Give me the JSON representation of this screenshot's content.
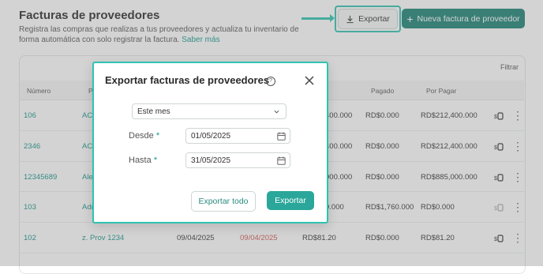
{
  "header": {
    "title": "Facturas de proveedores",
    "subtitle": "Registra las compras que realizas a tus proveedores y actualiza tu inventario de forma automática con solo registrar la factura.",
    "learn_more": "Saber más",
    "export_label": "Exportar",
    "new_label": "Nueva factura de proveedor"
  },
  "table": {
    "filter_label": "Filtrar",
    "columns": [
      "Número",
      "P",
      "Pagado",
      "Por Pagar"
    ],
    "rows": [
      {
        "numero": "106",
        "prov": "AC",
        "fecha": "",
        "venc": "",
        "total": "400.000",
        "pagado": "RD$0.000",
        "por_pagar": "RD$212,400.000"
      },
      {
        "numero": "2346",
        "prov": "AC",
        "fecha": "",
        "venc": "",
        "total": "400.000",
        "pagado": "RD$0.000",
        "por_pagar": "RD$212,400.000"
      },
      {
        "numero": "12345689",
        "prov": "Ale",
        "fecha": "",
        "venc": "",
        "total": "000.000",
        "pagado": "RD$0.000",
        "por_pagar": "RD$885,000.000"
      },
      {
        "numero": "103",
        "prov": "Adr",
        "fecha": "",
        "venc": "",
        "total": "0.000",
        "pagado": "RD$1,760.000",
        "por_pagar": "RD$0.000"
      },
      {
        "numero": "102",
        "prov": "z. Prov 1234",
        "fecha": "09/04/2025",
        "venc": "09/04/2025",
        "total": "RD$81.20",
        "pagado": "RD$0.000",
        "por_pagar": "RD$81.20"
      }
    ]
  },
  "modal": {
    "title": "Exportar facturas de proveedores",
    "period_value": "Este mes",
    "from_label": "Desde",
    "from_value": "01/05/2025",
    "to_label": "Hasta",
    "to_value": "31/05/2025",
    "required_mark": "*",
    "export_all_label": "Exportar todo",
    "export_label": "Exportar"
  },
  "colors": {
    "accent": "#1b8275",
    "teal_highlight": "#2fc3b1",
    "link": "#17968a",
    "overdue": "#d05555"
  }
}
